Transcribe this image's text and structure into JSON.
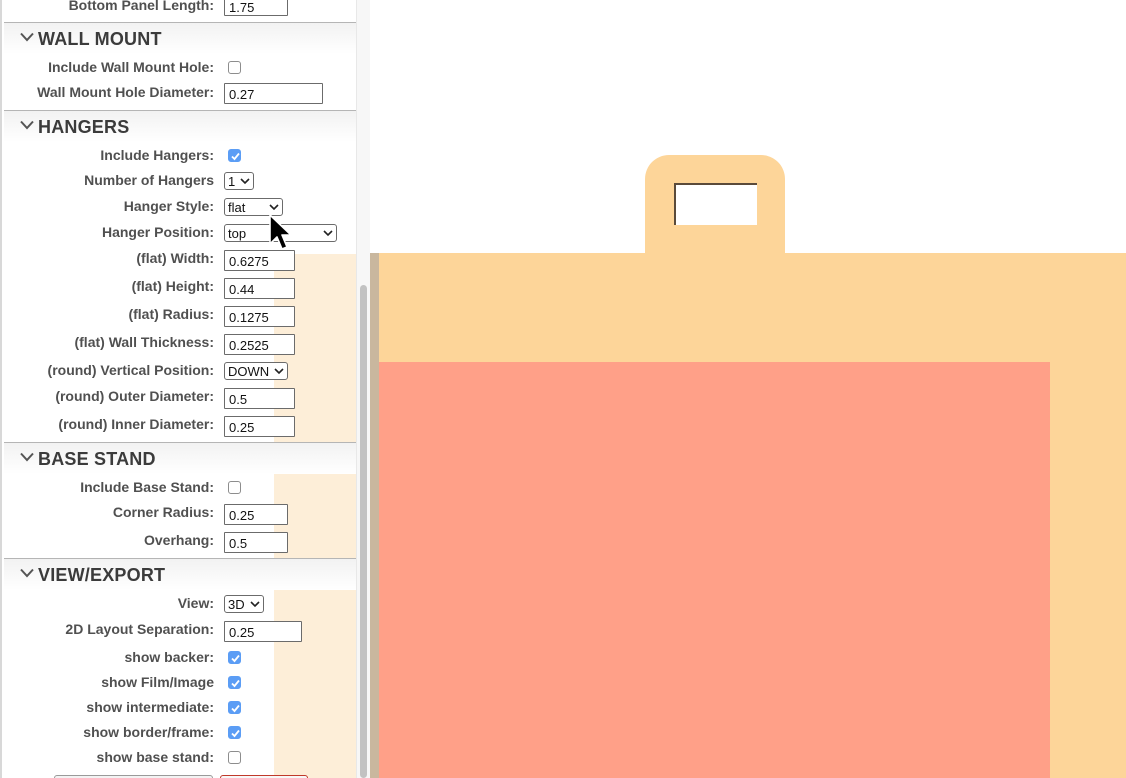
{
  "bottom_panel": {
    "label": "Bottom Panel Length:",
    "value": "1.75"
  },
  "wall_mount": {
    "title": "WALL MOUNT",
    "include_label": "Include Wall Mount Hole:",
    "include_checked": false,
    "diameter_label": "Wall Mount Hole Diameter:",
    "diameter_value": "0.27"
  },
  "hangers": {
    "title": "HANGERS",
    "include_label": "Include Hangers:",
    "include_checked": true,
    "count_label": "Number of Hangers",
    "count_value": "1",
    "style_label": "Hanger Style:",
    "style_value": "flat",
    "position_label": "Hanger Position:",
    "position_value": "top",
    "flat_width_label": "(flat) Width:",
    "flat_width_value": "0.6275",
    "flat_height_label": "(flat) Height:",
    "flat_height_value": "0.44",
    "flat_radius_label": "(flat) Radius:",
    "flat_radius_value": "0.1275",
    "flat_wall_label": "(flat) Wall Thickness:",
    "flat_wall_value": "0.2525",
    "round_vpos_label": "(round) Vertical Position:",
    "round_vpos_value": "DOWN",
    "round_outer_label": "(round) Outer Diameter:",
    "round_outer_value": "0.5",
    "round_inner_label": "(round) Inner Diameter:",
    "round_inner_value": "0.25"
  },
  "base_stand": {
    "title": "BASE STAND",
    "include_label": "Include Base Stand:",
    "include_checked": false,
    "corner_label": "Corner Radius:",
    "corner_value": "0.25",
    "overhang_label": "Overhang:",
    "overhang_value": "0.5"
  },
  "view_export": {
    "title": "VIEW/EXPORT",
    "view_label": "View:",
    "view_value": "3D",
    "separation_label": "2D Layout Separation:",
    "separation_value": "0.25",
    "show_backer_label": "show backer:",
    "show_backer_checked": true,
    "show_film_label": "show Film/Image",
    "show_film_checked": true,
    "show_intermediate_label": "show intermediate:",
    "show_intermediate_checked": true,
    "show_border_label": "show border/frame:",
    "show_border_checked": true,
    "show_base_label": "show base stand:",
    "show_base_checked": false
  },
  "colors": {
    "frame": "#fdd599",
    "film": "#ffa088",
    "checkbox_accent": "#5b9df5",
    "sidebar_highlight": "#fdeed8"
  },
  "icons": [
    "chevron-down-icon",
    "dropdown-arrow-icon",
    "checkmark-icon",
    "mouse-pointer-icon"
  ]
}
